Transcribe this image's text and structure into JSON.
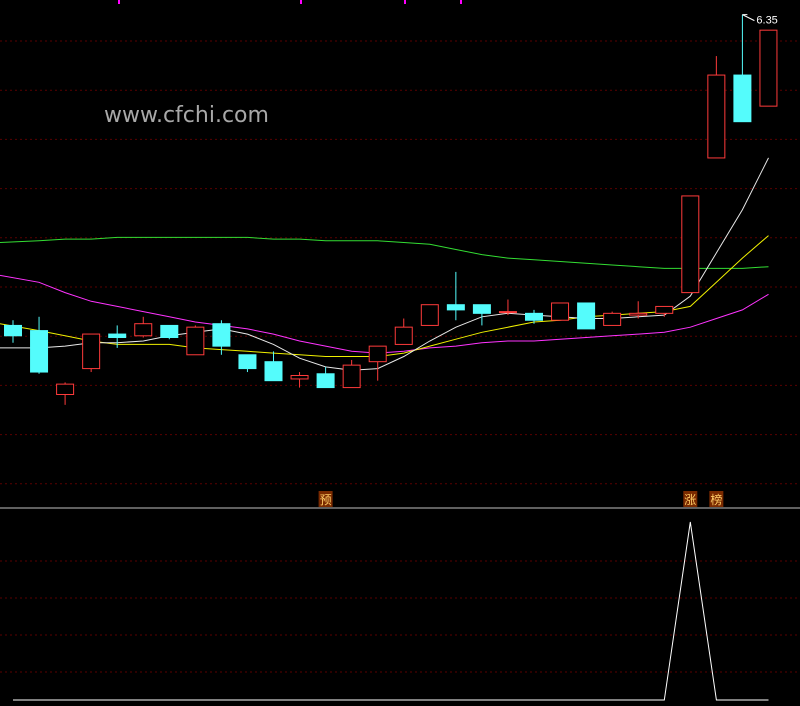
{
  "watermark": "www.cfchi.com",
  "colors": {
    "background": "#000000",
    "grid": "#5a0000",
    "divider": "#c0c0c0",
    "up": "#ff3b3b",
    "down": "#54fcfc",
    "ma_short": "#e8e8e8",
    "ma_mid": "#f0f000",
    "ma_long": "#ff33ff",
    "ma_longest": "#33dd33",
    "indicator": "#ffffff",
    "top_marks": "#ff00ff",
    "tag_bg": "#7a2a00",
    "tag_text": "#ffcc66",
    "price_label": "#ffffff"
  },
  "chart_data": [
    {
      "type": "candlestick",
      "title": "",
      "ylim": [
        3.62,
        6.4
      ],
      "grid": true,
      "candles": [
        {
          "open": 4.55,
          "close": 4.49,
          "high": 4.58,
          "low": 4.45
        },
        {
          "open": 4.52,
          "close": 4.28,
          "high": 4.6,
          "low": 4.27
        },
        {
          "open": 4.15,
          "close": 4.21,
          "high": 4.22,
          "low": 4.09
        },
        {
          "open": 4.3,
          "close": 4.5,
          "high": 4.5,
          "low": 4.28
        },
        {
          "open": 4.5,
          "close": 4.48,
          "high": 4.55,
          "low": 4.42
        },
        {
          "open": 4.49,
          "close": 4.56,
          "high": 4.6,
          "low": 4.48
        },
        {
          "open": 4.55,
          "close": 4.48,
          "high": 4.55,
          "low": 4.47
        },
        {
          "open": 4.38,
          "close": 4.54,
          "high": 4.55,
          "low": 4.38
        },
        {
          "open": 4.56,
          "close": 4.43,
          "high": 4.58,
          "low": 4.38
        },
        {
          "open": 4.38,
          "close": 4.3,
          "high": 4.38,
          "low": 4.28
        },
        {
          "open": 4.34,
          "close": 4.23,
          "high": 4.4,
          "low": 4.23
        },
        {
          "open": 4.24,
          "close": 4.26,
          "high": 4.28,
          "low": 4.19
        },
        {
          "open": 4.27,
          "close": 4.19,
          "high": 4.31,
          "low": 4.19
        },
        {
          "open": 4.19,
          "close": 4.32,
          "high": 4.35,
          "low": 4.19
        },
        {
          "open": 4.34,
          "close": 4.43,
          "high": 4.43,
          "low": 4.23
        },
        {
          "open": 4.44,
          "close": 4.54,
          "high": 4.59,
          "low": 4.44
        },
        {
          "open": 4.55,
          "close": 4.67,
          "high": 4.67,
          "low": 4.55
        },
        {
          "open": 4.67,
          "close": 4.64,
          "high": 4.86,
          "low": 4.58
        },
        {
          "open": 4.67,
          "close": 4.62,
          "high": 4.67,
          "low": 4.55
        },
        {
          "open": 4.63,
          "close": 4.63,
          "high": 4.7,
          "low": 4.61
        },
        {
          "open": 4.62,
          "close": 4.58,
          "high": 4.64,
          "low": 4.56
        },
        {
          "open": 4.58,
          "close": 4.68,
          "high": 4.68,
          "low": 4.58
        },
        {
          "open": 4.68,
          "close": 4.53,
          "high": 4.68,
          "low": 4.53
        },
        {
          "open": 4.55,
          "close": 4.62,
          "high": 4.63,
          "low": 4.55
        },
        {
          "open": 4.61,
          "close": 4.62,
          "high": 4.69,
          "low": 4.59
        },
        {
          "open": 4.62,
          "close": 4.66,
          "high": 4.66,
          "low": 4.6
        },
        {
          "open": 4.74,
          "close": 5.3,
          "high": 5.3,
          "low": 4.74
        },
        {
          "open": 5.52,
          "close": 6.0,
          "high": 6.11,
          "low": 5.52
        },
        {
          "open": 6.0,
          "close": 5.73,
          "high": 6.35,
          "low": 5.73
        },
        {
          "open": 5.82,
          "close": 6.26,
          "high": 6.26,
          "low": 5.82
        }
      ],
      "ma_short": [
        4.42,
        4.42,
        4.43,
        4.45,
        4.45,
        4.46,
        4.49,
        4.51,
        4.53,
        4.5,
        4.44,
        4.36,
        4.31,
        4.29,
        4.3,
        4.37,
        4.46,
        4.54,
        4.6,
        4.62,
        4.61,
        4.6,
        4.59,
        4.59,
        4.6,
        4.61,
        4.72,
        4.97,
        5.22,
        5.52
      ],
      "ma_mid": [
        4.56,
        4.52,
        4.49,
        4.46,
        4.44,
        4.44,
        4.44,
        4.42,
        4.41,
        4.4,
        4.39,
        4.38,
        4.37,
        4.37,
        4.37,
        4.39,
        4.43,
        4.47,
        4.51,
        4.54,
        4.57,
        4.58,
        4.6,
        4.61,
        4.62,
        4.63,
        4.66,
        4.8,
        4.94,
        5.07
      ],
      "ma_long": [
        4.84,
        4.8,
        4.74,
        4.69,
        4.66,
        4.63,
        4.6,
        4.57,
        4.55,
        4.53,
        4.5,
        4.46,
        4.43,
        4.4,
        4.39,
        4.4,
        4.42,
        4.43,
        4.45,
        4.46,
        4.46,
        4.47,
        4.48,
        4.49,
        4.5,
        4.51,
        4.54,
        4.59,
        4.64,
        4.73
      ],
      "ma_longest": [
        5.03,
        5.04,
        5.05,
        5.05,
        5.06,
        5.06,
        5.06,
        5.06,
        5.06,
        5.06,
        5.05,
        5.05,
        5.04,
        5.04,
        5.04,
        5.03,
        5.02,
        4.99,
        4.96,
        4.94,
        4.93,
        4.92,
        4.91,
        4.9,
        4.89,
        4.88,
        4.88,
        4.88,
        4.88,
        4.89
      ],
      "high_label": "6.35",
      "tags": [
        {
          "index": 12,
          "text": "预"
        },
        {
          "index": 26,
          "text": "涨"
        },
        {
          "index": 27,
          "text": "榜"
        }
      ]
    },
    {
      "type": "line",
      "title": "",
      "ylim": [
        0,
        1
      ],
      "values": [
        0,
        0,
        0,
        0,
        0,
        0,
        0,
        0,
        0,
        0,
        0,
        0,
        0,
        0,
        0,
        0,
        0,
        0,
        0,
        0,
        0,
        0,
        0,
        0,
        0,
        0,
        1,
        0,
        0,
        0
      ]
    }
  ]
}
